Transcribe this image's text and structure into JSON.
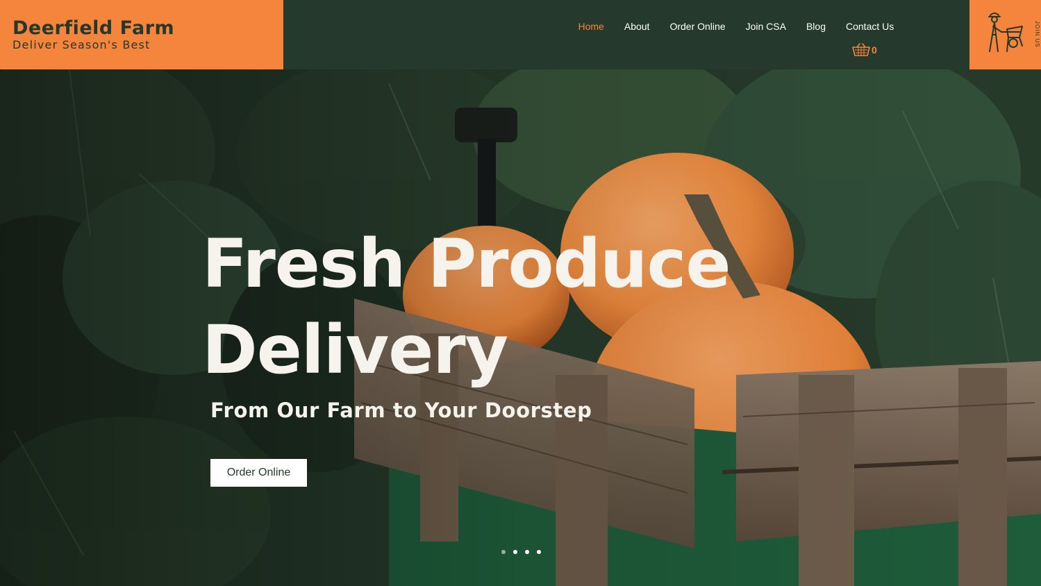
{
  "brand": {
    "name": "Deerfield Farm",
    "tagline": "Deliver Season's Best"
  },
  "nav": {
    "items": [
      {
        "label": "Home",
        "active": true
      },
      {
        "label": "About"
      },
      {
        "label": "Order Online"
      },
      {
        "label": "Join CSA"
      },
      {
        "label": "Blog"
      },
      {
        "label": "Contact Us"
      }
    ]
  },
  "cart": {
    "count": "0",
    "icon": "basket-icon"
  },
  "join": {
    "label": "JOIN US",
    "icon": "farmer-wheelbarrow-icon"
  },
  "hero": {
    "title_line1": "Fresh Produce",
    "title_line2": "Delivery",
    "subtitle": "From Our Farm to Your Doorstep",
    "button_label": "Order Online",
    "slides": 4,
    "active_slide": 2
  },
  "colors": {
    "brand_orange": "#f5843d",
    "header_green": "#253a2c",
    "hero_text": "#f6f3ec"
  }
}
